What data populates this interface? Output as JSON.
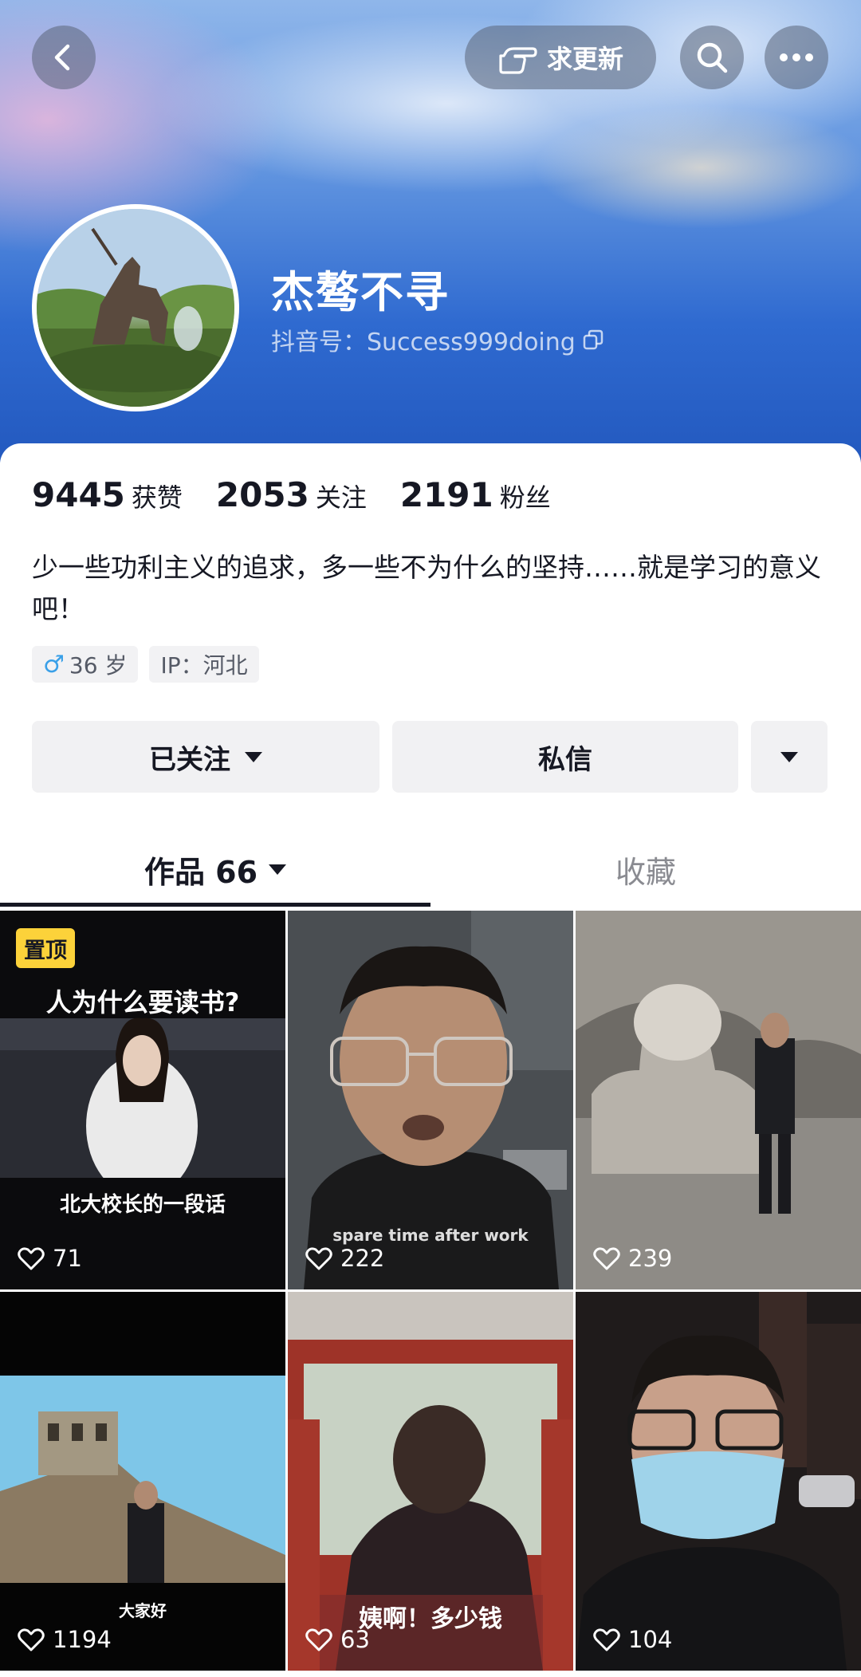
{
  "header": {
    "request_update_label": "求更新",
    "username": "杰骜不寻",
    "douyin_id": "抖音号：Success999doing"
  },
  "stats": [
    {
      "value": "9445",
      "label": "获赞"
    },
    {
      "value": "2053",
      "label": "关注"
    },
    {
      "value": "2191",
      "label": "粉丝"
    }
  ],
  "bio": "少一些功利主义的追求，多一些不为什么的坚持……就是学习的意义吧！",
  "tags": {
    "gender_symbol": "♂",
    "age": "36 岁",
    "ip": "IP：河北"
  },
  "actions": {
    "follow_label": "已关注",
    "message_label": "私信"
  },
  "tabs": {
    "works_label": "作品 66",
    "favorites_label": "收藏"
  },
  "videos": [
    {
      "pinned_label": "置顶",
      "title": "人为什么要读书?",
      "caption": "北大校长的一段话",
      "likes": "71"
    },
    {
      "caption": "spare time after work",
      "likes": "222"
    },
    {
      "likes": "239"
    },
    {
      "caption": "大家好",
      "likes": "1194"
    },
    {
      "caption": "姨啊！多少钱",
      "likes": "63"
    },
    {
      "likes": "104"
    }
  ],
  "colors": {
    "header_blue": "#2f6ad0",
    "pin_yellow": "#fcd23a",
    "gender_blue": "#3aa0e8"
  },
  "icons": [
    "back-arrow-icon",
    "pointing-hand-icon",
    "search-icon",
    "more-dots-icon",
    "copy-icon",
    "caret-down-icon",
    "heart-icon"
  ]
}
